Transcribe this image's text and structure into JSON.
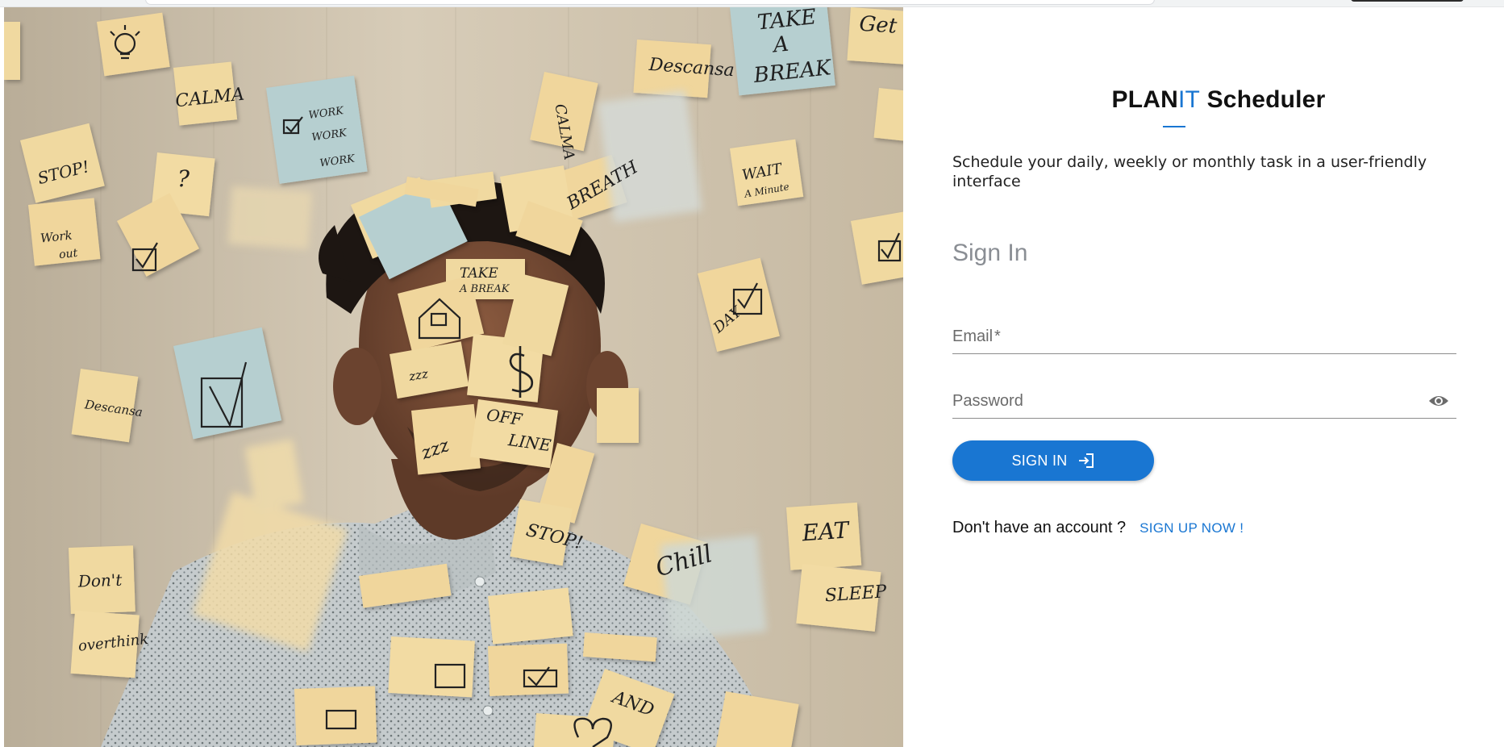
{
  "brand": {
    "part1": "PLAN",
    "accent": "IT",
    "part2": " Scheduler"
  },
  "subtitle": "Schedule your daily, weekly or monthly task in a user-friendly interface",
  "signin_heading": "Sign In",
  "email_field": {
    "label": "Email",
    "required_mark": "*",
    "value": ""
  },
  "password_field": {
    "label": "Password",
    "value": ""
  },
  "signin_button": {
    "label": "SIGN IN",
    "icon": "login-icon"
  },
  "signup": {
    "prompt": "Don't have an account ?",
    "link": "SIGN UP NOW !"
  },
  "hero": {
    "icons": [
      "lightbulb-icon",
      "checkbox-icon",
      "house-icon",
      "dollar-icon",
      "heart-icon"
    ],
    "notes": [
      "CALMA",
      "WORK",
      "STOP!",
      "?",
      "Work out",
      "Descansa",
      "TAKE A BREAK",
      "WAIT A Minute",
      "BREATH",
      "CALMA",
      "Get",
      "Descansa",
      "TAKE A BREAK",
      "ZZZ",
      "OFF LINE",
      "STOP!",
      "Don't",
      "overthink",
      "EAT",
      "SLEEP",
      "Chill",
      "AND",
      "DAY"
    ]
  },
  "colors": {
    "primary": "#1976d2",
    "sticky_yellow": "#f0d9a0",
    "sticky_blue": "#b6cfd0",
    "wall": "#cfc3ad"
  }
}
